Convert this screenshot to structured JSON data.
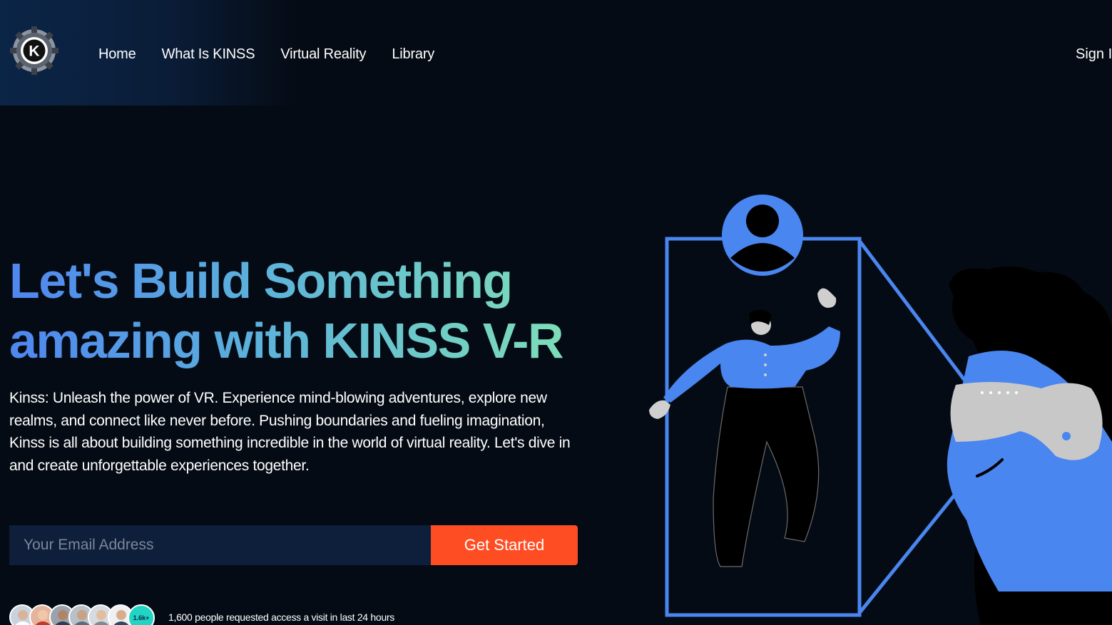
{
  "header": {
    "logo_letter": "K",
    "nav": [
      "Home",
      "What Is KINSS",
      "Virtual Reality",
      "Library"
    ],
    "signin_label": "Sign I"
  },
  "hero": {
    "title_line1": "Let's Build Something",
    "title_line2": "amazing with KINSS V-R",
    "description": "Kinss: Unleash the power of VR. Experience mind-blowing adventures, explore new realms, and connect like never before. Pushing boundaries and fueling imagination, Kinss is all about building something incredible in the world of virtual reality. Let's dive in and create unforgettable experiences together.",
    "email_placeholder": "Your Email Address",
    "cta_label": "Get Started",
    "badge_count": "1.6k+",
    "requests_text": "1,600 people requested access a visit in last 24 hours"
  },
  "colors": {
    "background": "#050b14",
    "accent": "#ff4d23",
    "input_bg": "#0d1f3b",
    "illustration_blue": "#4a86f0",
    "badge": "#21d4c4"
  },
  "icons": {
    "logo": "gear-k-logo-icon",
    "illustration": "vr-user-illustration"
  }
}
